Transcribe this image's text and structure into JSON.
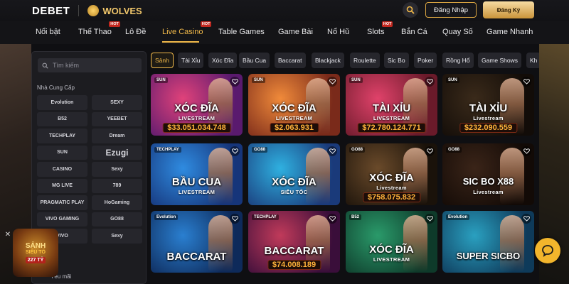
{
  "header": {
    "logo": "DEBET",
    "partner": "WOLVES",
    "login_label": "Đăng Nhập",
    "register_label": "Đăng Ký"
  },
  "nav": {
    "items": [
      {
        "label": "Nổi bật",
        "hot": false
      },
      {
        "label": "Thể Thao",
        "hot": true
      },
      {
        "label": "Lô Đề",
        "hot": false
      },
      {
        "label": "Live Casino",
        "hot": true,
        "active": true
      },
      {
        "label": "Table Games",
        "hot": false
      },
      {
        "label": "Game Bài",
        "hot": false
      },
      {
        "label": "Nổ Hũ",
        "hot": false
      },
      {
        "label": "Slots",
        "hot": true
      },
      {
        "label": "Bắn Cá",
        "hot": false
      },
      {
        "label": "Quay Số",
        "hot": false
      },
      {
        "label": "Game Nhanh",
        "hot": false
      }
    ],
    "hot_badge": "HOT"
  },
  "sidebar": {
    "search_placeholder": "Tìm kiếm",
    "section_title": "Nhà Cung Cấp",
    "providers": [
      "Evolution",
      "SEXY",
      "B52",
      "YEEBET",
      "TECHPLAY",
      "Dream",
      "SUN",
      "Ezugi",
      "CASINO",
      "Sexy",
      "MG LIVE",
      "789",
      "PRAGMATIC PLAY",
      "HoGaming",
      "VIVO GAMING",
      "GO88",
      "VIVO",
      "Sexy"
    ],
    "bottom_label": "Yêu mãi"
  },
  "promo": {
    "line1": "SẢNH",
    "line2": "SIÊU TỐ",
    "line3": "227 TỶ"
  },
  "chips": [
    "Sảnh",
    "Tài Xỉu",
    "Xóc Đĩa",
    "Bầu Cua",
    "Baccarat",
    "Blackjack",
    "Roulette",
    "Sic Bo",
    "Poker",
    "Rồng Hổ",
    "Game Shows",
    "Kh"
  ],
  "games": [
    {
      "tag": "SUN",
      "title": "XÓC ĐĨA",
      "sub": "LIVESTREAM",
      "jackpot": "$33.051.034.748",
      "c1": "#e0427a",
      "c2": "#5a1a6e"
    },
    {
      "tag": "SUN",
      "title": "XÓC ĐĨA",
      "sub": "LIVESTREAM",
      "jackpot": "$2.063.931",
      "c1": "#f08a3a",
      "c2": "#7a2a1a"
    },
    {
      "tag": "SUN",
      "title": "TÀI XỈU",
      "sub": "LIVESTREAM",
      "jackpot": "$72.780.124.771",
      "c1": "#e0426a",
      "c2": "#6a1a2a"
    },
    {
      "tag": "SUN",
      "title": "TÀI XỈU",
      "sub": "Livestream",
      "jackpot": "$232.090.559",
      "c1": "#3a2a1a",
      "c2": "#120c08"
    },
    {
      "tag": "TECHPLAY",
      "title": "BẦU CUA",
      "sub": "LIVESTREAM",
      "jackpot": "",
      "c1": "#2f8be0",
      "c2": "#16357a"
    },
    {
      "tag": "GO88",
      "title": "XÓC ĐĨA",
      "sub": "SIÊU TỐC",
      "jackpot": "",
      "c1": "#2fb0e0",
      "c2": "#1a3a7a"
    },
    {
      "tag": "GO88",
      "title": "XÓC ĐĨA",
      "sub": "Livestream",
      "jackpot": "$758.075.832",
      "c1": "#6a4a2a",
      "c2": "#1a120a"
    },
    {
      "tag": "GO88",
      "title": "SIC BO X88",
      "sub": "Livestream",
      "jackpot": "",
      "c1": "#3a2418",
      "c2": "#120a06"
    },
    {
      "tag": "Evolution",
      "title": "BACCARAT",
      "sub": "",
      "jackpot": "",
      "c1": "#2a7fd0",
      "c2": "#0e2a5a"
    },
    {
      "tag": "TECHPLAY",
      "title": "BACCARAT",
      "sub": "",
      "jackpot": "$74.008.189",
      "c1": "#c03a5a",
      "c2": "#3a0e3a"
    },
    {
      "tag": "B52",
      "title": "XÓC ĐĨA",
      "sub": "LIVESTREAM",
      "jackpot": "",
      "c1": "#2a9a6a",
      "c2": "#0e3a2a"
    },
    {
      "tag": "Evolution",
      "title": "SUPER SICBO",
      "sub": "",
      "jackpot": "",
      "c1": "#2aa0c0",
      "c2": "#0e3a5a"
    }
  ],
  "colors": {
    "accent": "#f1b94a",
    "hot": "#c3281f",
    "background": "#0f0f12",
    "panel": "#1c1c20",
    "jackpot_text": "#ffb23a",
    "chat": "#f2b52c"
  }
}
